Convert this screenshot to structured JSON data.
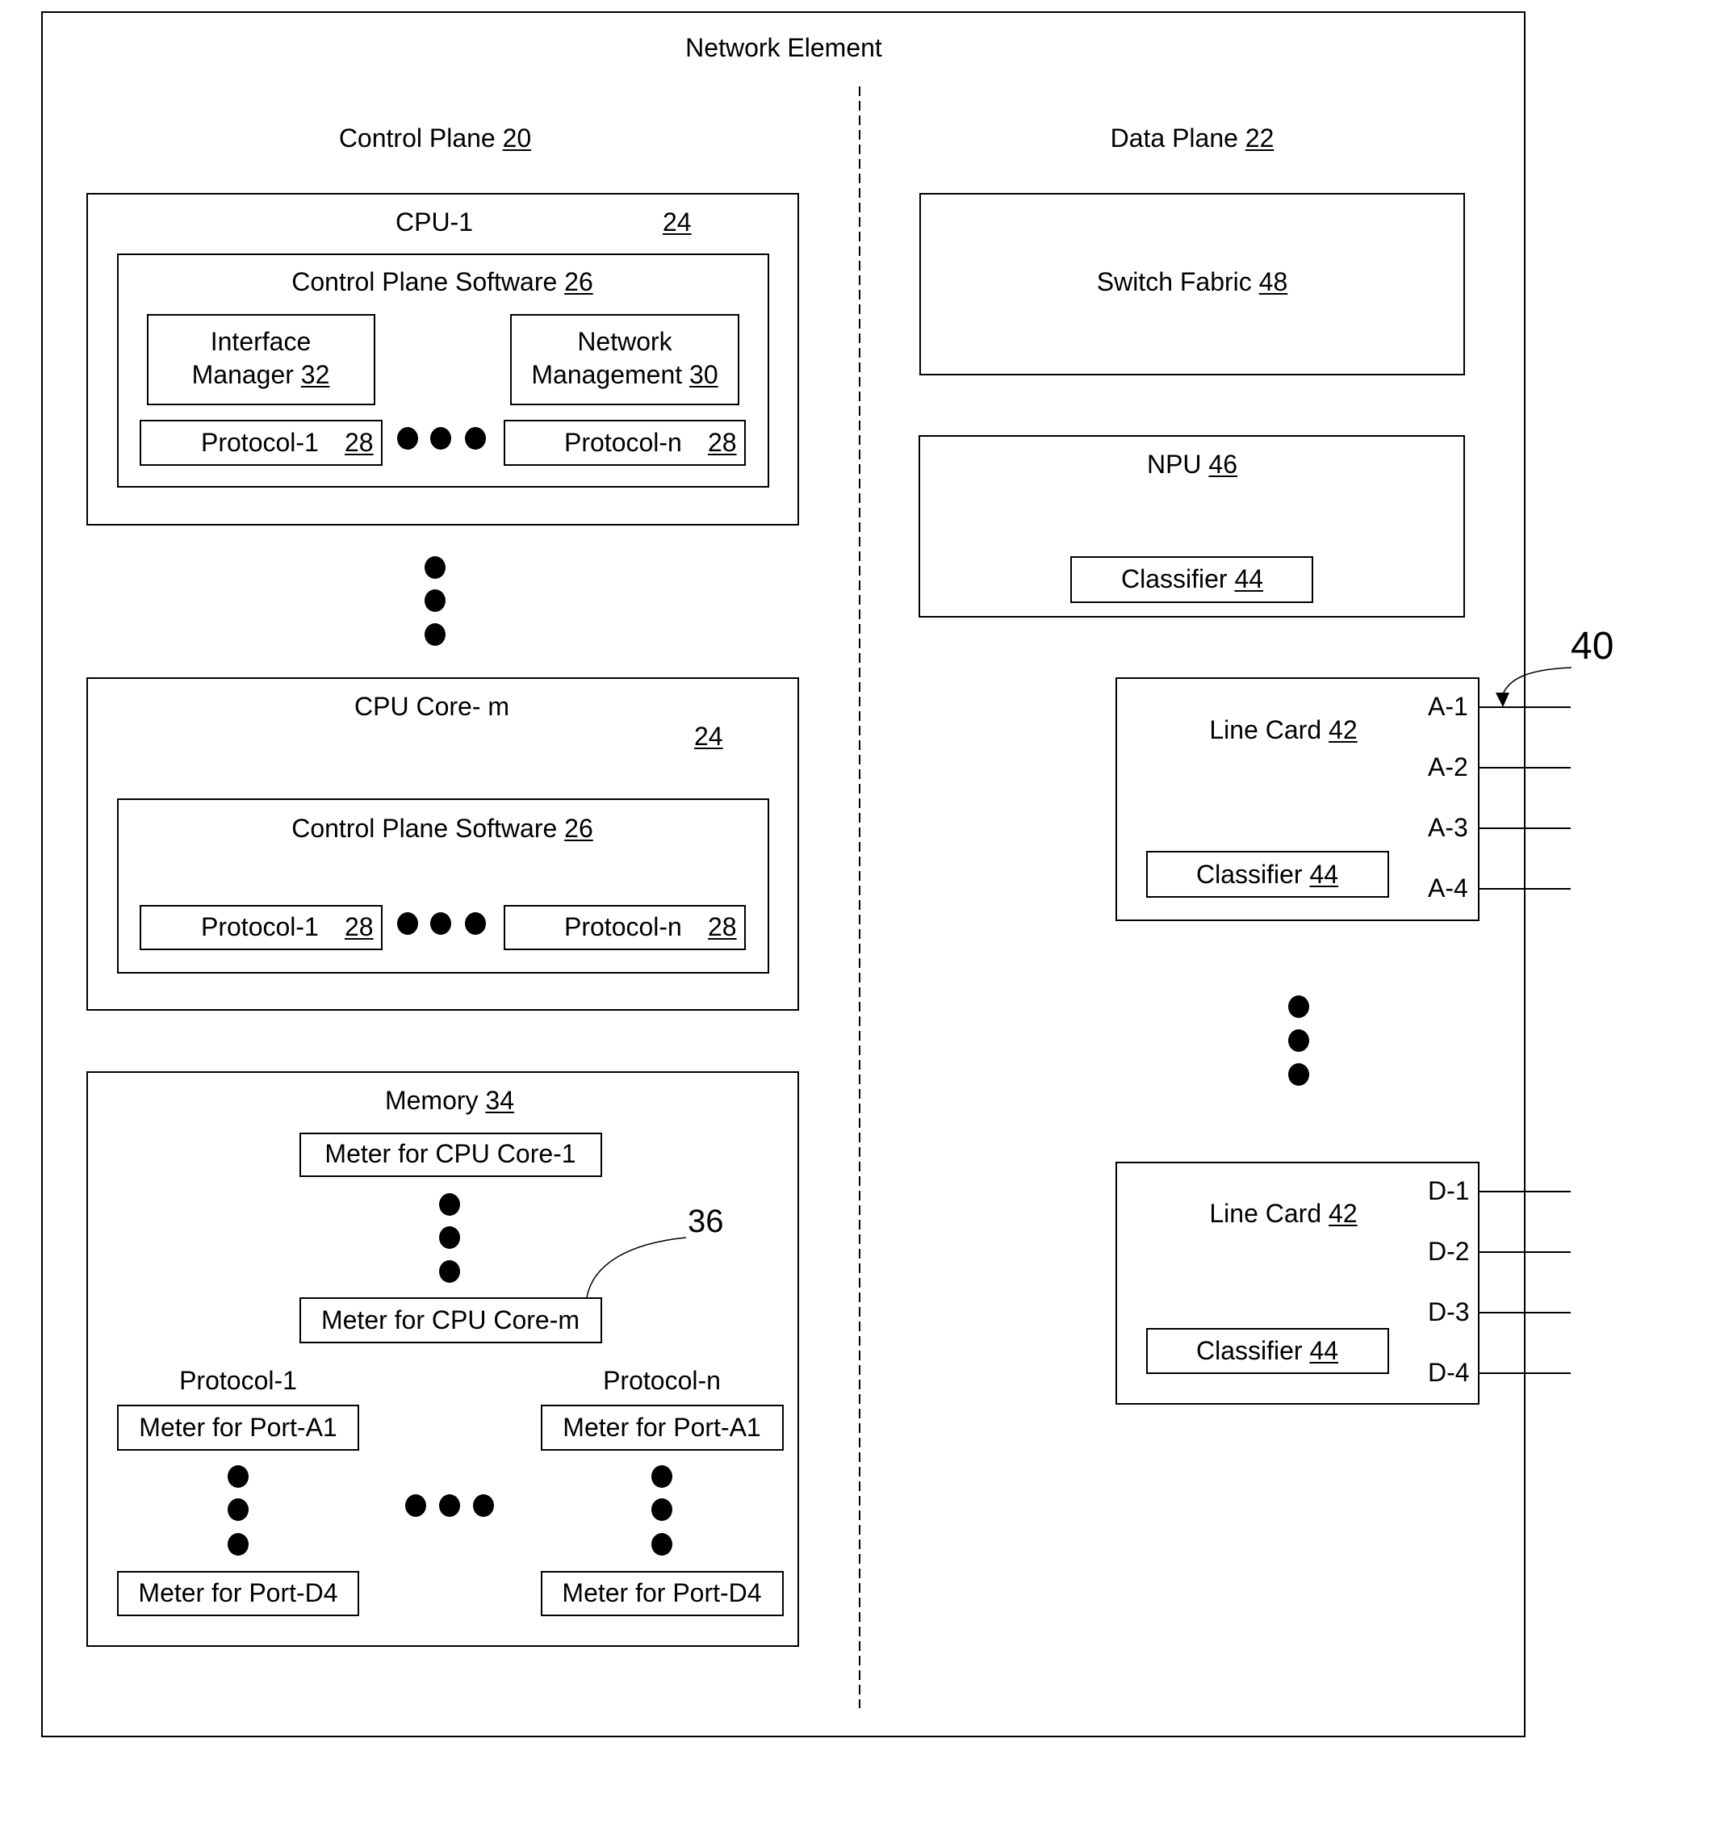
{
  "title": "Network Element",
  "control_plane": {
    "label": "Control Plane",
    "ref": "20",
    "cpu1": {
      "label": "CPU-1",
      "ref": "24",
      "software": {
        "label": "Control Plane Software",
        "ref": "26",
        "interface_manager": {
          "line1": "Interface",
          "line2": "Manager",
          "ref": "32"
        },
        "network_management": {
          "line1": "Network",
          "line2": "Management",
          "ref": "30"
        },
        "protocol_1": {
          "label": "Protocol-1",
          "ref": "28"
        },
        "protocol_n": {
          "label": "Protocol-n",
          "ref": "28"
        }
      }
    },
    "cpu_core_m": {
      "label": "CPU Core- m",
      "ref": "24",
      "software": {
        "label": "Control Plane Software",
        "ref": "26",
        "protocol_1": {
          "label": "Protocol-1",
          "ref": "28"
        },
        "protocol_n": {
          "label": "Protocol-n",
          "ref": "28"
        }
      }
    },
    "memory": {
      "label": "Memory",
      "ref": "34",
      "meter_core_1": "Meter for CPU Core-1",
      "meter_core_m": "Meter for CPU Core-m",
      "meter_callout": "36",
      "protocol_1": {
        "label": "Protocol-1",
        "meter_a1": "Meter for Port-A1",
        "meter_d4": "Meter for Port-D4"
      },
      "protocol_n": {
        "label": "Protocol-n",
        "meter_a1": "Meter for Port-A1",
        "meter_d4": "Meter for Port-D4"
      }
    }
  },
  "data_plane": {
    "label": "Data Plane",
    "ref": "22",
    "switch_fabric": {
      "label": "Switch Fabric",
      "ref": "48"
    },
    "npu": {
      "label": "NPU",
      "ref": "46",
      "classifier": {
        "label": "Classifier",
        "ref": "44"
      }
    },
    "line_card_a": {
      "label": "Line Card",
      "ref": "42",
      "classifier": {
        "label": "Classifier",
        "ref": "44"
      },
      "ports": [
        "A-1",
        "A-2",
        "A-3",
        "A-4"
      ]
    },
    "line_card_d": {
      "label": "Line Card",
      "ref": "42",
      "classifier": {
        "label": "Classifier",
        "ref": "44"
      },
      "ports": [
        "D-1",
        "D-2",
        "D-3",
        "D-4"
      ]
    },
    "ports_callout": "40"
  }
}
